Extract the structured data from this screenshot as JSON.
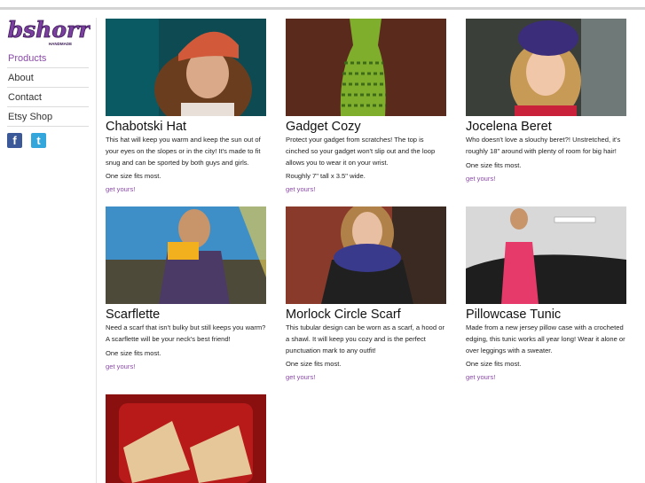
{
  "brand": {
    "name": "bshorr",
    "tagline": "HANDMADE"
  },
  "nav": [
    {
      "label": "Products",
      "active": true
    },
    {
      "label": "About"
    },
    {
      "label": "Contact"
    },
    {
      "label": "Etsy Shop"
    }
  ],
  "social": [
    {
      "icon": "facebook-icon",
      "glyph": "f",
      "color": "#3b5998"
    },
    {
      "icon": "twitter-icon",
      "glyph": "t",
      "color": "#33a6dc"
    }
  ],
  "products": [
    {
      "title": "Chabotski Hat",
      "desc": "This hat will keep you warm and keep the sun out of your eyes on the slopes or in the city!  It's made to fit snug and can be sported by both guys and girls.",
      "size": "One size fits most.",
      "link": "get yours!"
    },
    {
      "title": "Gadget Cozy",
      "desc": "Protect your gadget from scratches!  The top is cinched so your gadget won't slip out and the loop allows you to wear it on your wrist.",
      "size": "Roughly 7\" tall x 3.5\" wide.",
      "link": "get yours!"
    },
    {
      "title": "Jocelena Beret",
      "desc": "Who doesn't love a slouchy beret?!  Unstretched, it's roughly 18\" around with plenty of room for big hair!",
      "size": "One size fits most.",
      "link": "get yours!"
    },
    {
      "title": "Scarflette",
      "desc": "Need a scarf that isn't bulky but still keeps you warm? A scarflette will be your neck's best friend!",
      "size": "One size fits most.",
      "link": "get yours!"
    },
    {
      "title": "Morlock Circle Scarf",
      "desc": "This tubular design can be worn as a scarf, a hood or a shawl.  It will keep you cozy and is the perfect punctuation mark to any outfit!",
      "size": "One size fits most.",
      "link": "get yours!"
    },
    {
      "title": "Pillowcase Tunic",
      "desc": "Made from a new jersey pillow case with a crocheted edging, this tunic works all year long! Wear it alone or over leggings with a sweater.",
      "size": "One size fits most.",
      "link": "get yours!"
    }
  ],
  "accent": "#8a4aa8"
}
